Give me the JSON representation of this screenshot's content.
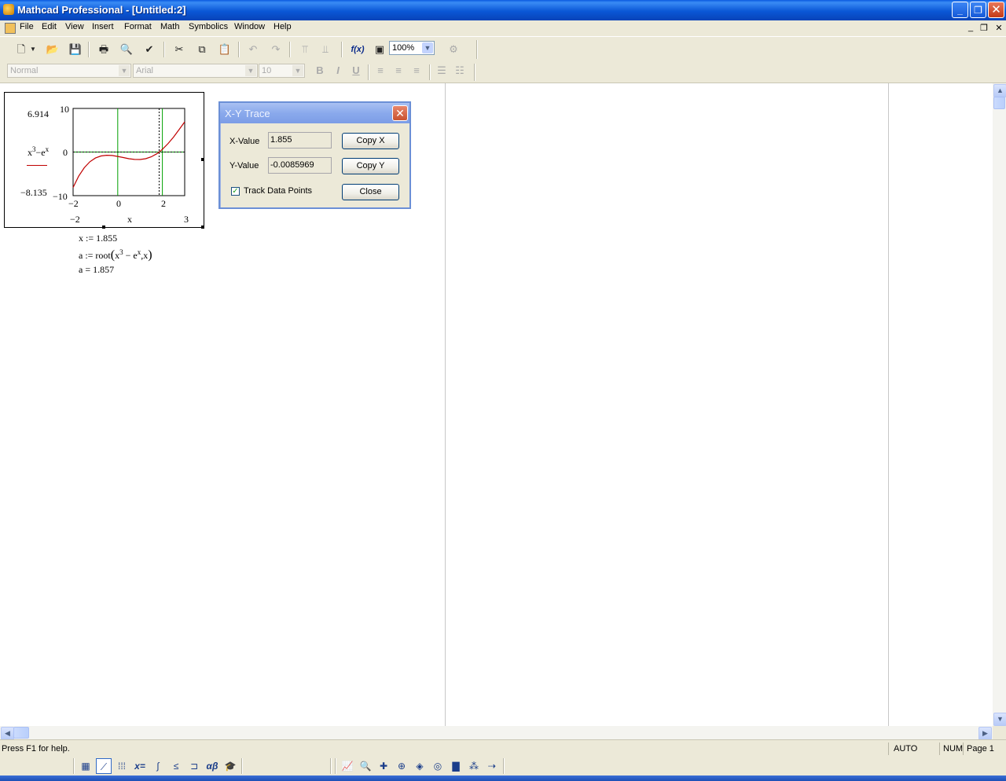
{
  "window": {
    "title": "Mathcad Professional - [Untitled:2]",
    "controls": {
      "minimize": "_",
      "restore": "❐",
      "close": "✕"
    }
  },
  "menubar": {
    "items": [
      "File",
      "Edit",
      "View",
      "Insert",
      "Format",
      "Math",
      "Symbolics",
      "Window",
      "Help"
    ],
    "mdi_controls": {
      "minimize": "_",
      "restore": "❐",
      "close": "✕"
    }
  },
  "toolbar": {
    "icons": [
      "new-document-icon",
      "open-folder-icon",
      "save-icon",
      "print-icon",
      "print-preview-icon",
      "spell-check-icon",
      "cut-icon",
      "copy-icon",
      "paste-icon",
      "undo-icon",
      "redo-icon",
      "align-top-icon",
      "align-down-icon",
      "insert-function-icon",
      "insert-unit-icon",
      "resource-center-icon"
    ],
    "zoom": "100%",
    "function_label": "f(x)"
  },
  "format_bar": {
    "style": "Normal",
    "font": "Arial",
    "size": "10",
    "bold": "B",
    "italic": "I",
    "underline": "U"
  },
  "plot": {
    "y_max_label": "10",
    "y_zero_label": "0",
    "y_min_label": "10",
    "y_marker_top": "6.914",
    "y_marker_bottom": "8.135",
    "x_tick_labels": [
      "2",
      "0",
      "2"
    ],
    "x_min_label": "2",
    "x_max_label": "3",
    "x_axis_name": "x",
    "y_expression_base": "x",
    "y_expression_exp1": "3",
    "y_expression_op": "−e",
    "y_expression_exp2": "x",
    "minus": "−",
    "colors": {
      "curve": "#c00000",
      "trace_line": "#00a000",
      "frame": "#000000"
    }
  },
  "chart_data": {
    "type": "line",
    "title": "",
    "xlabel": "x",
    "ylabel": "x^3 − e^x",
    "xlim": [
      -2,
      3
    ],
    "ylim": [
      -10,
      10
    ],
    "x_markers": [
      0,
      2
    ],
    "y_markers": [
      -8.135,
      6.914
    ],
    "series": [
      {
        "x": [
          -2,
          -1.75,
          -1.5,
          -1.25,
          -1,
          -0.75,
          -0.5,
          -0.25,
          0,
          0.25,
          0.5,
          0.75,
          1,
          1.25,
          1.5,
          1.75,
          1.855,
          2,
          2.25,
          2.5,
          2.75,
          3
        ],
        "values": [
          -8.135,
          -5.533,
          -3.598,
          -2.239,
          -1.368,
          -0.894,
          -0.732,
          -0.794,
          -1.0,
          -1.269,
          -1.524,
          -1.695,
          -1.718,
          -1.537,
          -1.106,
          -0.395,
          0.0,
          0.611,
          1.903,
          3.43,
          5.154,
          6.914
        ]
      }
    ],
    "trace_x": 1.855,
    "trace_y": -0.0085969
  },
  "math": {
    "line1": "x := 1.855",
    "line2_prefix": "a := root",
    "line2_base": "x",
    "line2_exp1": "3",
    "line2_mid": " − e",
    "line2_exp2": "x",
    "line2_suffix": ",x",
    "line3": "a = 1.857"
  },
  "dialog": {
    "title": "X-Y Trace",
    "x_label": "X-Value",
    "x_value": "1.855",
    "y_label": "Y-Value",
    "y_value": "-0.0085969",
    "copy_x": "Copy X",
    "copy_y": "Copy Y",
    "track_label": "Track Data Points",
    "track_checked": true,
    "close": "Close"
  },
  "status": {
    "help": "Press F1 for help.",
    "mode": "AUTO",
    "num": "NUM",
    "page": "Page 1"
  },
  "math_toolbar": {
    "icons": [
      "calculator-icon",
      "graph-icon",
      "matrix-icon",
      "evaluation-icon",
      "calculus-icon",
      "boolean-icon",
      "programming-icon",
      "greek-icon",
      "symbolic-icon"
    ],
    "eval_label": "x=",
    "greek_label": "αβ"
  },
  "graph_toolbar": {
    "icons": [
      "xy-plot-icon",
      "polar-plot-icon",
      "surface-plot-icon",
      "contour-plot-icon",
      "3d-scatter-icon",
      "3d-bar-icon",
      "vector-field-icon",
      "zoom-icon",
      "trace-icon"
    ]
  }
}
